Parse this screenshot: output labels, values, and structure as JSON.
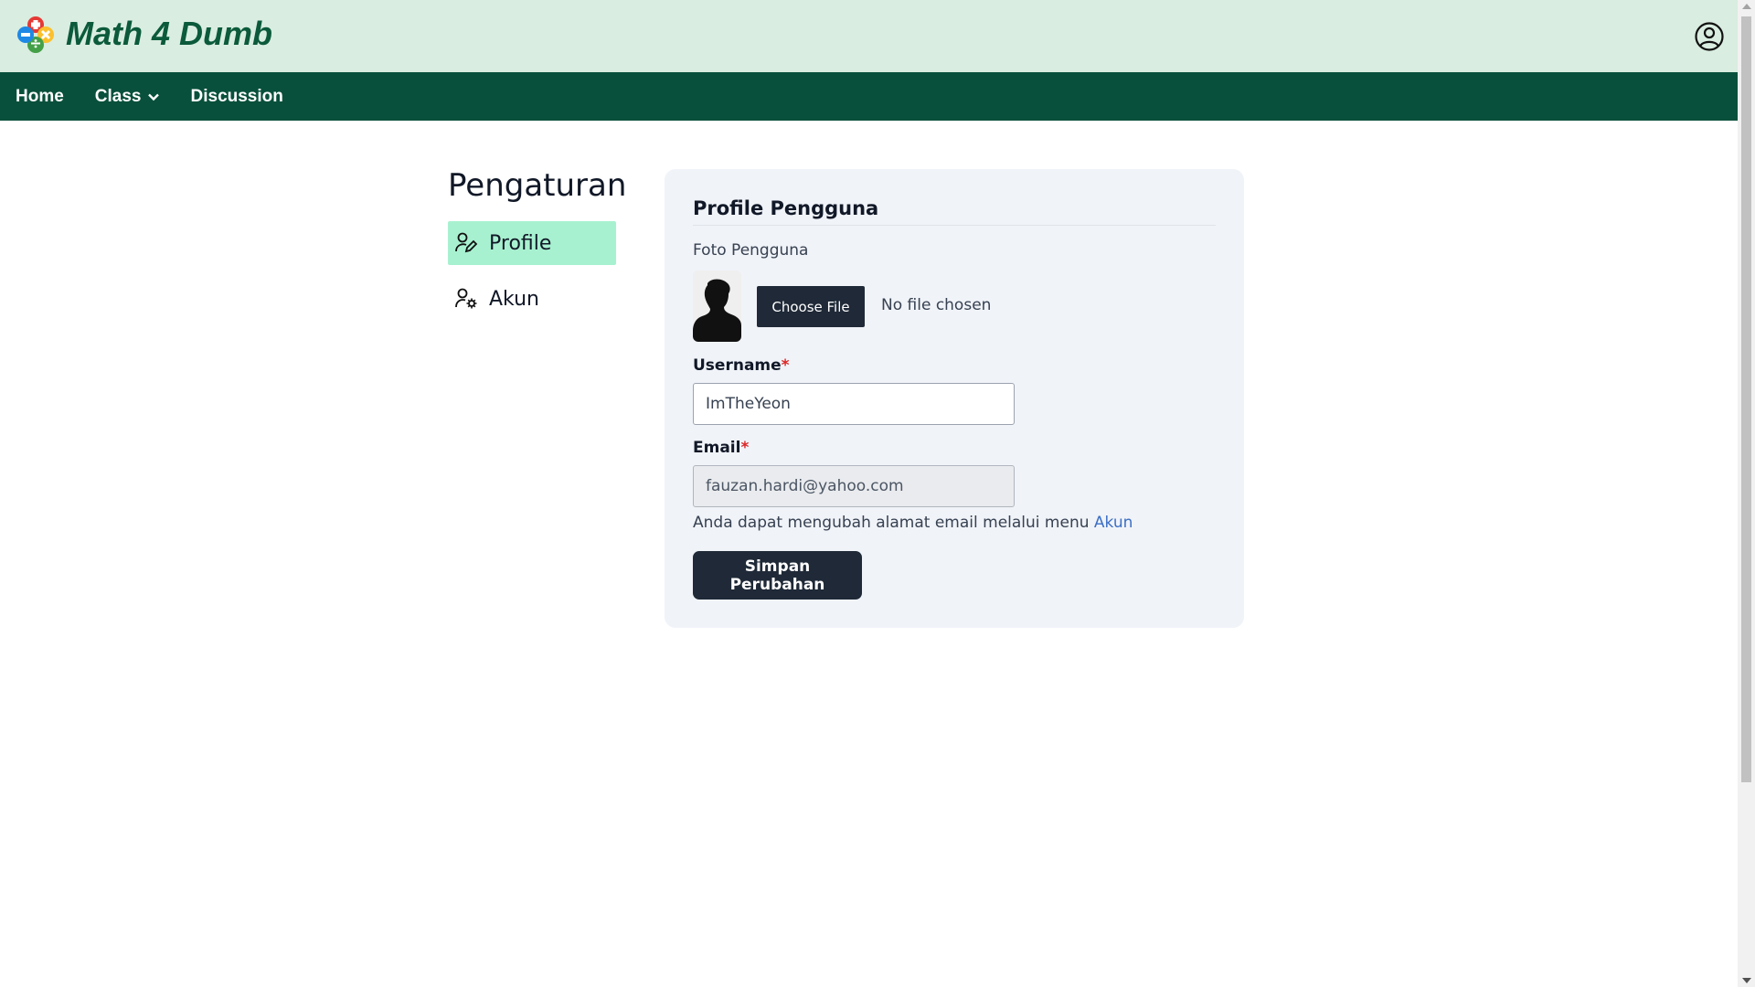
{
  "header": {
    "brand": "Math 4 Dumb",
    "logo_icon": "math-operators-logo",
    "user_icon": "user-circle-icon",
    "bg_color": "#d9ede0",
    "brand_color": "#0b5a3b"
  },
  "nav": {
    "items": [
      {
        "label": "Home"
      },
      {
        "label": "Class"
      },
      {
        "label": "Discussion"
      }
    ],
    "bg_color": "#08503b"
  },
  "sidebar": {
    "title": "Pengaturan",
    "items": [
      {
        "label": "Profile",
        "icon": "user-edit-icon",
        "active": true
      },
      {
        "label": "Akun",
        "icon": "user-gear-icon",
        "active": false
      }
    ],
    "active_color": "#a8f1d0"
  },
  "profile_form": {
    "title": "Profile Pengguna",
    "photo_label": "Foto Pengguna",
    "choose_file_label": "Choose File",
    "file_status": "No file chosen",
    "username_label": "Username",
    "username_value": "ImTheYeon",
    "email_label": "Email",
    "email_value": "fauzan.hardi@yahoo.com",
    "required_mark": "*",
    "hint_text": "Anda dapat mengubah alamat email melalui menu ",
    "hint_link": "Akun",
    "save_label": "Simpan Perubahan"
  }
}
